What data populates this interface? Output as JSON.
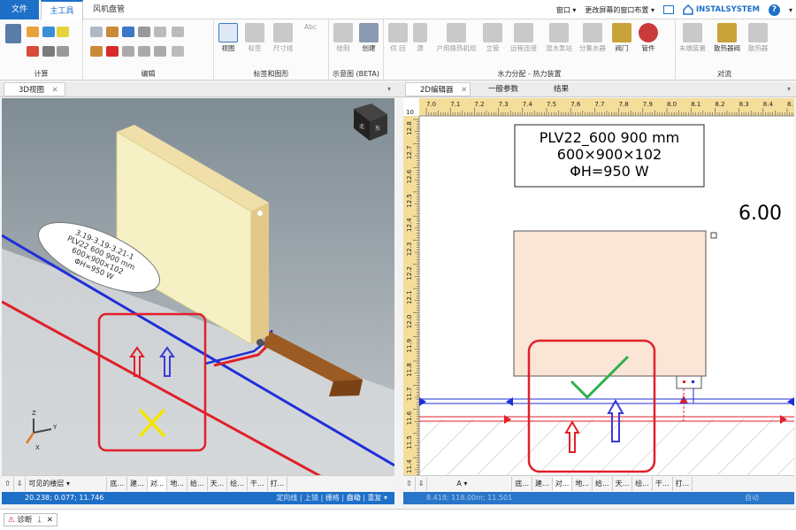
{
  "ribbon_tabs": {
    "file": "文件",
    "main": "主工具",
    "duct": "风机盘管"
  },
  "window_menu": "窗口",
  "layout_menu": "更改屏幕的窗口布置",
  "brand": "INSTALSYSTEM",
  "help": "?",
  "groups": {
    "calc": "计算",
    "edit": "编辑",
    "labels": "标签和图形",
    "schematic": "示意图 (BETA)",
    "hydraulic": "水力分配 - 热力装置",
    "convection": "对流"
  },
  "buttons": {
    "view": "视图",
    "label": "标签",
    "dimension": "尺寸线",
    "abc": "Abc",
    "draw": "绘制",
    "create": "创建",
    "supply": "供 回",
    "source": "源",
    "household": "户用换热机组",
    "riser": "立管",
    "remote": "远程连接",
    "pump": "混水泵站",
    "manifold": "分集水器",
    "valve": "阀门",
    "fitting": "管件",
    "endunit": "末端装置",
    "radvalve": "散热器阀",
    "radiator": "散热器"
  },
  "left_tab": "3D视图",
  "right_tabs": [
    "2D编辑器",
    "一般参数",
    "结果"
  ],
  "label_3d": [
    "3.19-3.19-3.21-1",
    "PLV22 600 900 mm",
    "600×900×102",
    "ΦH=950 W"
  ],
  "cube_faces": [
    "北",
    "东"
  ],
  "axes": {
    "z": "Z",
    "y": "Y",
    "x": "X"
  },
  "bar_left": [
    "可见的楼层",
    "底...",
    "建...",
    "对...",
    "地...",
    "给...",
    "天...",
    "绘...",
    "干...",
    "打..."
  ],
  "bar_right": [
    "A",
    "底...",
    "建...",
    "对...",
    "地...",
    "给...",
    "天...",
    "绘...",
    "干...",
    "打..."
  ],
  "status_left": {
    "coords": "20.238; 0.077; 11.746",
    "items": [
      "定向线",
      "上锁",
      "栅格",
      "自动",
      "重复"
    ]
  },
  "status_right": {
    "coords": "8.418; 118.00m; 11.501",
    "items": [
      "自动"
    ]
  },
  "radiator_label": [
    "PLV22_600 900 mm",
    "600×900×102",
    "ΦH=950 W"
  ],
  "dim_value": "6.00",
  "ruler_x": [
    "7.0",
    "7.1",
    "7.2",
    "7.3",
    "7.4",
    "7.5",
    "7.6",
    "7.7",
    "7.8",
    "7.9",
    "8.0",
    "8.1",
    "8.2",
    "8.3",
    "8.4",
    "8."
  ],
  "ruler_y": [
    "12.8",
    "12.7",
    "12.6",
    "12.5",
    "12.4",
    "12.3",
    "12.2",
    "12.1",
    "12.0",
    "11.9",
    "11.8",
    "11.7",
    "11.6",
    "11.5",
    "11.4"
  ],
  "ruler_corner": "10",
  "diag": "诊断",
  "colors": {
    "accent": "#1e6fc8",
    "red": "#e0202a",
    "blue": "#1f2fd8",
    "green": "#2fb14a",
    "yellow": "#f4e500"
  }
}
